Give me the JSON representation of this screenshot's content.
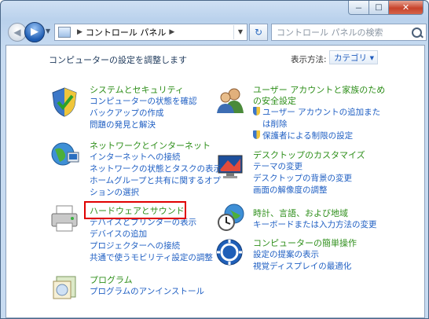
{
  "window": {
    "buttons": {
      "minimize": "－",
      "maximize": "□",
      "close": "✕"
    }
  },
  "nav": {
    "address": {
      "crumb": "コントロール パネル",
      "separator_icon": "chevron-right"
    },
    "search_placeholder": "コントロール パネルの検索"
  },
  "content": {
    "heading": "コンピューターの設定を調整します",
    "view_by_label": "表示方法:",
    "view_by_value": "カテゴリ",
    "categories": [
      {
        "title": "システムとセキュリティ",
        "icon": "shield-checkmark",
        "links": [
          "コンピューターの状態を確認",
          "バックアップの作成",
          "問題の発見と解決"
        ]
      },
      {
        "title": "ネットワークとインターネット",
        "icon": "globe-network",
        "links": [
          "インターネットへの接続",
          "ネットワークの状態とタスクの表示",
          "ホームグループと共有に関するオプ",
          "ションの選択"
        ]
      },
      {
        "title": "ハードウェアとサウンド",
        "icon": "printer",
        "links": [
          "デバイスとプリンターの表示",
          "デバイスの追加",
          "プロジェクターへの接続",
          "共通で使うモビリティ設定の調整"
        ]
      },
      {
        "title": "プログラム",
        "icon": "program-box",
        "links": [
          "プログラムのアンインストール"
        ]
      },
      {
        "title": "ユーザー アカウントと家族のため",
        "title2": "の安全設定",
        "icon": "users",
        "links": [
          "ユーザー アカウントの追加また",
          "は削除",
          "保護者による制限の設定"
        ]
      },
      {
        "title": "デスクトップのカスタマイズ",
        "icon": "monitor-paint",
        "links": [
          "テーマの変更",
          "デスクトップの背景の変更",
          "画面の解像度の調整"
        ]
      },
      {
        "title": "時計、言語、および地域",
        "icon": "clock-globe",
        "links": [
          "キーボードまたは入力方法の変更"
        ]
      },
      {
        "title": "コンピューターの簡単操作",
        "icon": "ease-of-access",
        "links": [
          "設定の提案の表示",
          "視覚ディスプレイの最適化"
        ]
      }
    ]
  },
  "colors": {
    "category_title": "#2f8f1b",
    "link": "#1f5fc3",
    "highlight": "#e00000"
  }
}
